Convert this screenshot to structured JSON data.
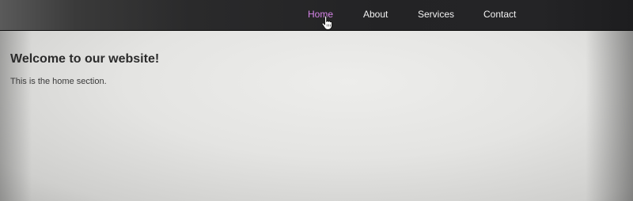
{
  "nav": {
    "items": [
      {
        "label": "Home",
        "active": true
      },
      {
        "label": "About",
        "active": false
      },
      {
        "label": "Services",
        "active": false
      },
      {
        "label": "Contact",
        "active": false
      }
    ],
    "active_color": "#d684e8",
    "text_color": "#f2f2f2"
  },
  "main": {
    "heading": "Welcome to our website!",
    "paragraph": "This is the home section."
  },
  "cursor": {
    "icon": "hand-pointer-icon"
  }
}
